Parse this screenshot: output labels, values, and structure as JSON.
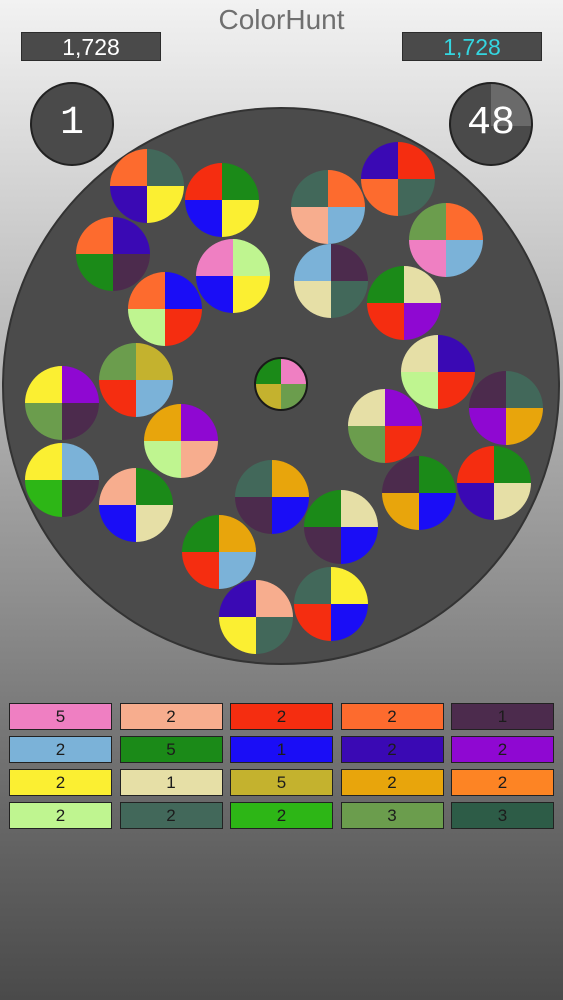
{
  "header": {
    "title": "ColorHunt",
    "score_left": "1,728",
    "score_right": "1,728",
    "counter_left": "1",
    "counter_right": "48",
    "score_right_color": "#34d6e0"
  },
  "colors": {
    "pink": "#ef7fc2",
    "peach": "#f7ad8e",
    "red": "#f52d10",
    "orange": "#fd6b2e",
    "plum": "#4c2b4d",
    "sky": "#7bb2d8",
    "green": "#1b8a18",
    "blue": "#1a0df6",
    "indigo": "#3a09b4",
    "purple": "#8f08d2",
    "yellow": "#fbef32",
    "cream": "#e6dfa6",
    "olive": "#c4b22e",
    "amber": "#e8a50c",
    "tangerine": "#fd8424",
    "lime": "#bff590",
    "teal": "#42685a",
    "kelly": "#2db616",
    "sage": "#6b9d4d",
    "pine": "#2d5c47"
  },
  "palette": [
    {
      "color": "pink",
      "count": "5"
    },
    {
      "color": "peach",
      "count": "2"
    },
    {
      "color": "red",
      "count": "2"
    },
    {
      "color": "orange",
      "count": "2"
    },
    {
      "color": "plum",
      "count": "1"
    },
    {
      "color": "sky",
      "count": "2"
    },
    {
      "color": "green",
      "count": "5"
    },
    {
      "color": "blue",
      "count": "1"
    },
    {
      "color": "indigo",
      "count": "2"
    },
    {
      "color": "purple",
      "count": "2"
    },
    {
      "color": "yellow",
      "count": "2"
    },
    {
      "color": "cream",
      "count": "1"
    },
    {
      "color": "olive",
      "count": "5"
    },
    {
      "color": "amber",
      "count": "2"
    },
    {
      "color": "tangerine",
      "count": "2"
    },
    {
      "color": "lime",
      "count": "2"
    },
    {
      "color": "teal",
      "count": "2"
    },
    {
      "color": "kelly",
      "count": "2"
    },
    {
      "color": "sage",
      "count": "3"
    },
    {
      "color": "pine",
      "count": "3"
    }
  ],
  "center_piece": [
    "pink",
    "sage",
    "olive",
    "green"
  ],
  "pieces": [
    [
      "teal",
      "yellow",
      "indigo",
      "orange"
    ],
    [
      "green",
      "yellow",
      "blue",
      "red"
    ],
    [
      "indigo",
      "plum",
      "green",
      "orange"
    ],
    [
      "lime",
      "yellow",
      "blue",
      "pink"
    ],
    [
      "blue",
      "red",
      "lime",
      "orange"
    ],
    [
      "orange",
      "sky",
      "peach",
      "teal"
    ],
    [
      "red",
      "teal",
      "orange",
      "indigo"
    ],
    [
      "orange",
      "sky",
      "pink",
      "sage"
    ],
    [
      "plum",
      "teal",
      "cream",
      "sky"
    ],
    [
      "cream",
      "purple",
      "red",
      "green"
    ],
    [
      "indigo",
      "red",
      "lime",
      "cream"
    ],
    [
      "teal",
      "amber",
      "purple",
      "plum"
    ],
    [
      "olive",
      "sky",
      "red",
      "sage"
    ],
    [
      "purple",
      "plum",
      "sage",
      "yellow"
    ],
    [
      "purple",
      "peach",
      "lime",
      "amber"
    ],
    [
      "purple",
      "red",
      "sage",
      "cream"
    ],
    [
      "green",
      "blue",
      "amber",
      "plum"
    ],
    [
      "green",
      "cream",
      "indigo",
      "red"
    ],
    [
      "sky",
      "plum",
      "kelly",
      "yellow"
    ],
    [
      "green",
      "cream",
      "blue",
      "peach"
    ],
    [
      "amber",
      "blue",
      "plum",
      "teal"
    ],
    [
      "cream",
      "blue",
      "plum",
      "green"
    ],
    [
      "amber",
      "sky",
      "red",
      "green"
    ],
    [
      "peach",
      "teal",
      "yellow",
      "indigo"
    ],
    [
      "yellow",
      "blue",
      "red",
      "teal"
    ]
  ]
}
